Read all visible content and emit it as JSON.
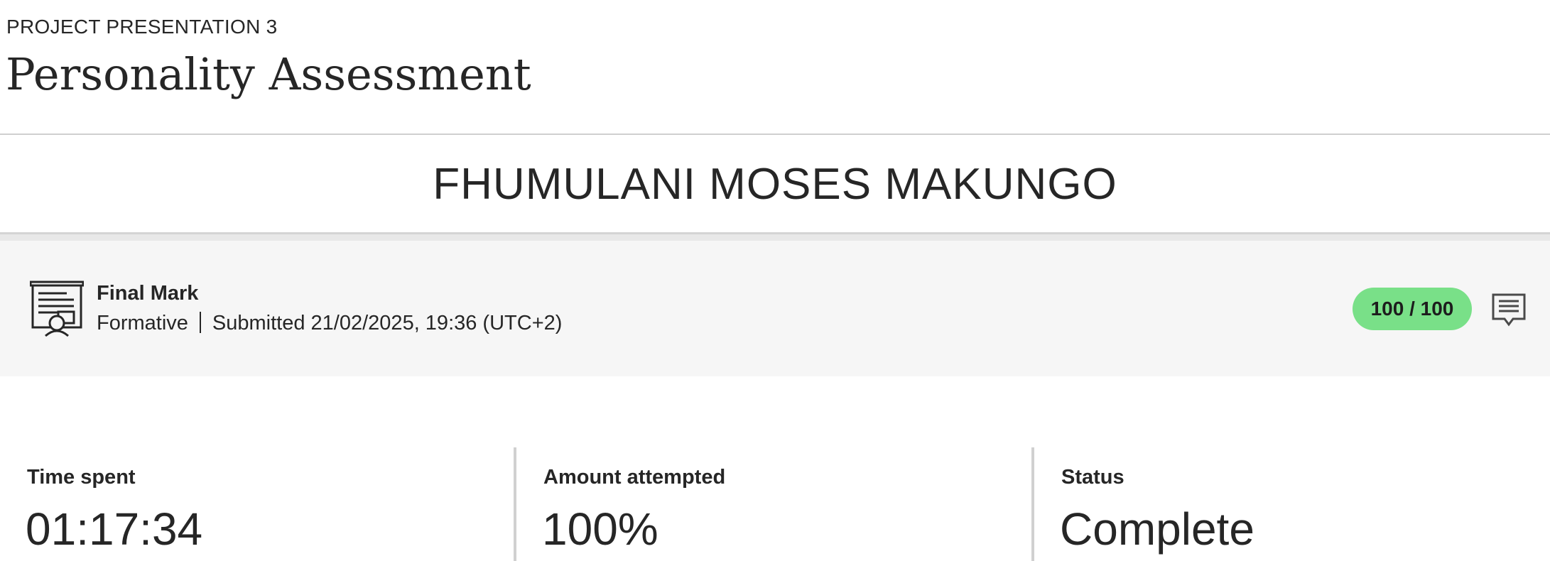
{
  "header": {
    "eyebrow": "PROJECT PRESENTATION 3",
    "title": "Personality Assessment"
  },
  "student": {
    "name": "FHUMULANI MOSES MAKUNGO"
  },
  "final_mark": {
    "icon": "assessment-board-icon",
    "title": "Final Mark",
    "type": "Formative",
    "submitted": "Submitted 21/02/2025, 19:36 (UTC+2)",
    "grade": "100 / 100",
    "grade_color": "#79e088",
    "feedback_icon": "comment-icon"
  },
  "stats": [
    {
      "label": "Time spent",
      "value": "01:17:34"
    },
    {
      "label": "Amount attempted",
      "value": "100%"
    },
    {
      "label": "Status",
      "value": "Complete"
    }
  ]
}
